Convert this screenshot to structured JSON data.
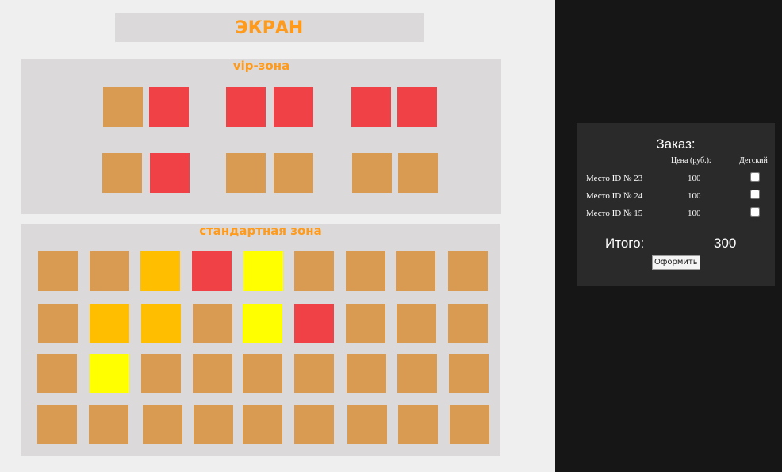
{
  "screen": {
    "label": "ЭКРАН"
  },
  "zones": {
    "vip": {
      "title": "vip-зона"
    },
    "standard": {
      "title": "стандартная зона"
    }
  },
  "colors": {
    "free": "#d99b52",
    "taken": "#ef4146",
    "selected": "#ffbf00",
    "highlight": "#ffff00"
  },
  "vip_rows": [
    [
      "free",
      "taken",
      "taken",
      "taken",
      "taken",
      "taken"
    ],
    [
      "free",
      "taken",
      "free",
      "free",
      "free",
      "free"
    ]
  ],
  "standard_rows": [
    [
      "free",
      "free",
      "selected",
      "taken",
      "highlight",
      "free",
      "free",
      "free",
      "free"
    ],
    [
      "free",
      "selected",
      "selected",
      "free",
      "highlight",
      "taken",
      "free",
      "free",
      "free"
    ],
    [
      "free",
      "highlight",
      "free",
      "free",
      "free",
      "free",
      "free",
      "free",
      "free"
    ],
    [
      "free",
      "free",
      "free",
      "free",
      "free",
      "free",
      "free",
      "free",
      "free"
    ]
  ],
  "order": {
    "title": "Заказ:",
    "price_header": "Цена (руб.):",
    "child_header": "Детский",
    "items": [
      {
        "seat": "Место ID № 23",
        "price": "100"
      },
      {
        "seat": "Место ID № 24",
        "price": "100"
      },
      {
        "seat": "Место ID № 15",
        "price": "100"
      }
    ],
    "total_label": "Итого:",
    "total_value": "300",
    "submit_label": "Оформить"
  }
}
